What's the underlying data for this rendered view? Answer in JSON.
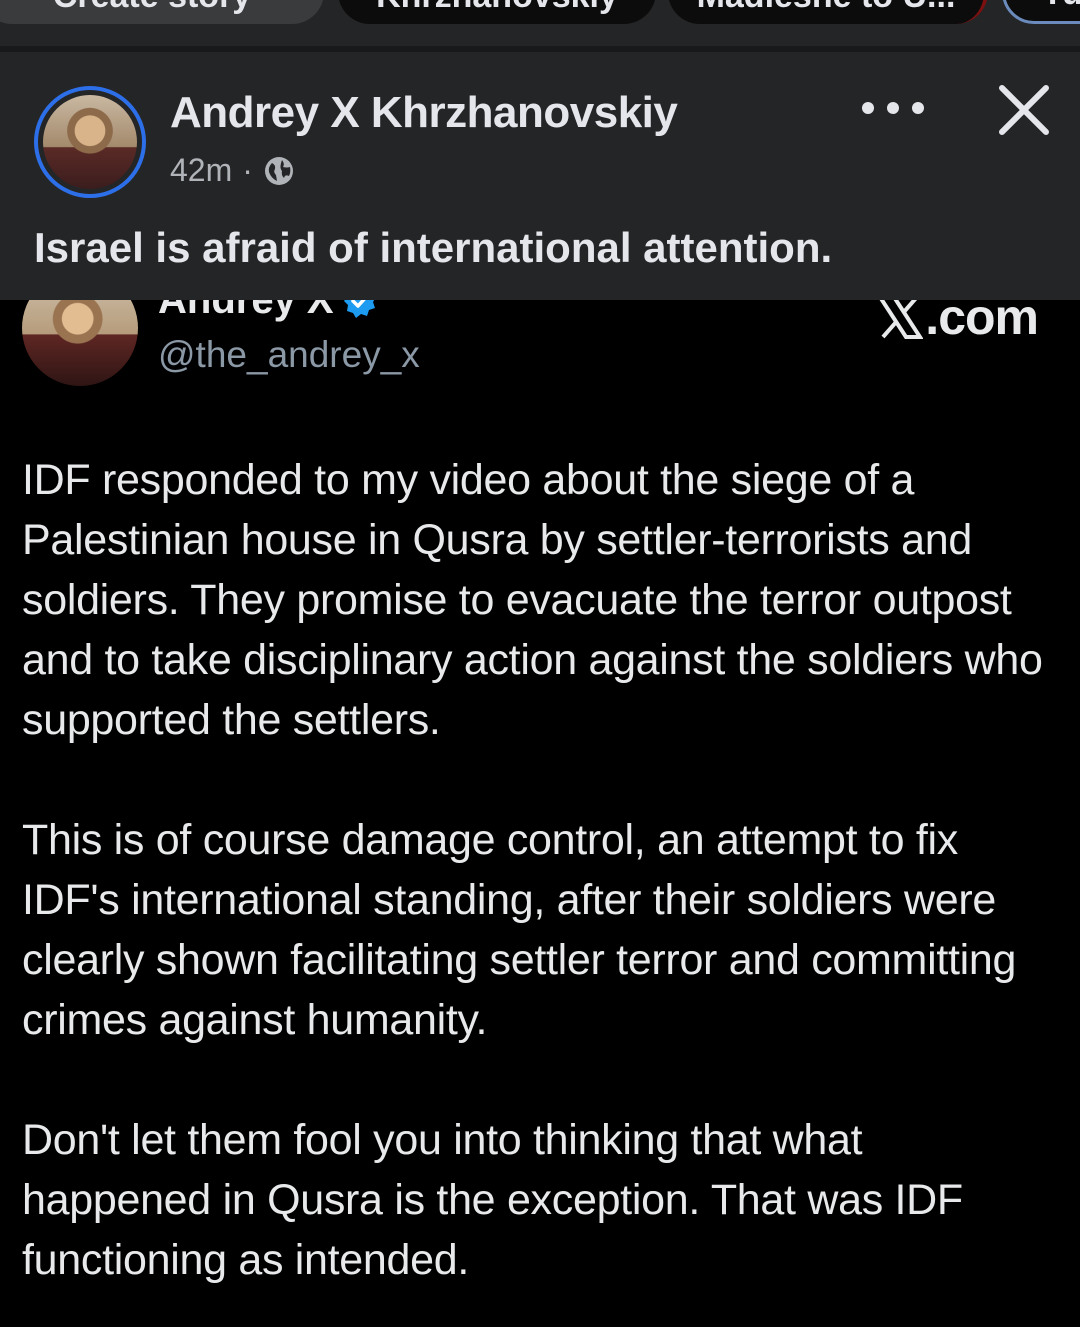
{
  "stories": {
    "chips": [
      "Create story",
      "Khrzhanovskiy",
      "Madieshe to U...",
      "Yu"
    ]
  },
  "post": {
    "author": "Andrey X Khrzhanovskiy",
    "time": "42m",
    "separator": "·",
    "caption": "Israel is afraid of international attention."
  },
  "tweet": {
    "name": "Andrey X",
    "handle": "@the_andrey_x",
    "source": ".com",
    "paragraphs": [
      "IDF responded to my video about the siege of a Palestinian house in Qusra by settler-terrorists and soldiers. They promise to evacuate the terror outpost and to take disciplinary action against the soldiers who supported the settlers.",
      "This is of course damage control, an attempt to fix IDF's international standing, after their soldiers were clearly shown facilitating settler terror and committing crimes against humanity.",
      "Don't let them fool you into thinking that what happened in Qusra is the exception. That was IDF functioning as intended."
    ]
  },
  "colors": {
    "header_bg": "#242526",
    "ring": "#2d6fe8",
    "verified": "#1d9bf0"
  }
}
